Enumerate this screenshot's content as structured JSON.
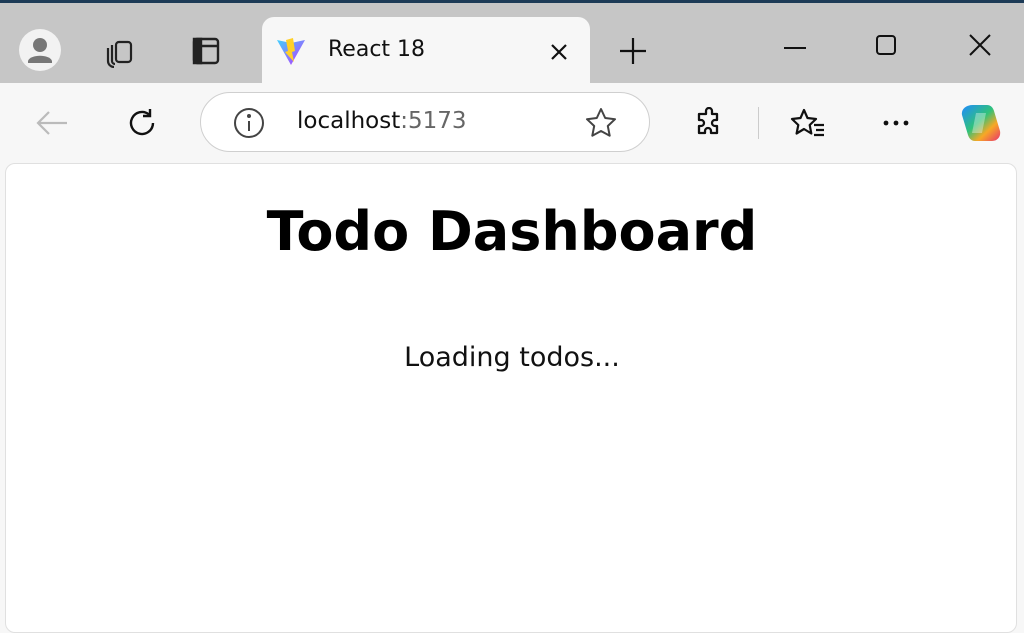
{
  "browser": {
    "tab": {
      "title": "React 18",
      "favicon": "vite-logo-icon"
    },
    "address": {
      "host": "localhost",
      "port": ":5173"
    },
    "icons": [
      "profile-icon",
      "workspaces-icon",
      "tab-actions-icon",
      "close-tab-icon",
      "new-tab-icon",
      "minimize-icon",
      "maximize-icon",
      "close-window-icon",
      "back-icon",
      "refresh-icon",
      "site-info-icon",
      "favorite-star-icon",
      "extensions-icon",
      "favorites-icon",
      "more-icon",
      "copilot-icon"
    ]
  },
  "page": {
    "title": "Todo Dashboard",
    "status": "Loading todos..."
  }
}
